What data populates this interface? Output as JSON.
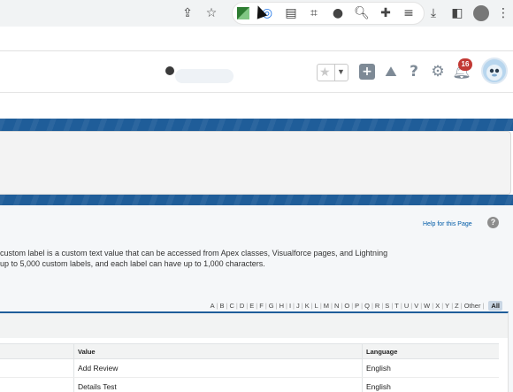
{
  "browser": {
    "icons": [
      "share-icon",
      "star-bookmark-icon",
      "extension-green-icon",
      "extension-cursor-icon",
      "extension-window-icon",
      "crop-icon",
      "chat-icon",
      "search-ext-icon",
      "puzzle-icon",
      "playlist-icon",
      "download-icon",
      "sidepanel-icon",
      "profile-avatar-icon",
      "kebab-menu-icon"
    ]
  },
  "header": {
    "notification_count": "16",
    "icons": [
      "favorites-star-icon",
      "add-icon",
      "trailhead-icon",
      "help-icon",
      "gear-icon",
      "bell-icon"
    ]
  },
  "page": {
    "help_link": "Help for this Page",
    "description_line1": "custom label is a custom text value that can be accessed from Apex classes, Visualforce pages, and Lightning",
    "description_line2": "up to 5,000 custom labels, and each label can have up to 1,000 characters."
  },
  "alpha_filter": [
    "A",
    "B",
    "C",
    "D",
    "E",
    "F",
    "G",
    "H",
    "I",
    "J",
    "K",
    "L",
    "M",
    "N",
    "O",
    "P",
    "Q",
    "R",
    "S",
    "T",
    "U",
    "V",
    "W",
    "X",
    "Y",
    "Z",
    "Other",
    "All"
  ],
  "table": {
    "headers": {
      "value": "Value",
      "language": "Language"
    },
    "rows": [
      {
        "value": "Add Review",
        "language": "English"
      },
      {
        "value": "Details Test",
        "language": "English"
      }
    ]
  },
  "colors": {
    "brand_blue": "#1f5d99",
    "link": "#015ba7",
    "badge_red": "#c23934"
  }
}
